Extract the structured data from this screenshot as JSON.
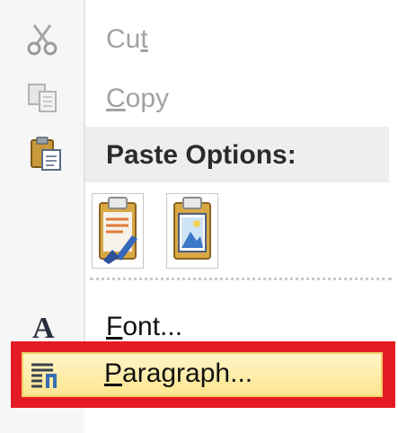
{
  "menu": {
    "cut": {
      "prefix": "Cu",
      "mnemonic": "t",
      "suffix": "",
      "icon": "scissors-icon",
      "enabled": false
    },
    "copy": {
      "prefix": "",
      "mnemonic": "C",
      "suffix": "opy",
      "icon": "copy-icon",
      "enabled": false
    },
    "paste_options": {
      "label": "Paste Options:",
      "icon": "clipboard-icon"
    },
    "paste_buttons": [
      {
        "name": "keep-text-only",
        "icon": "paste-text-only-icon"
      },
      {
        "name": "picture",
        "icon": "paste-picture-icon"
      }
    ],
    "font": {
      "prefix": "",
      "mnemonic": "F",
      "suffix": "ont...",
      "icon": "font-icon",
      "glyph": "A"
    },
    "paragraph": {
      "prefix": "",
      "mnemonic": "P",
      "suffix": "aragraph...",
      "icon": "paragraph-icon",
      "highlighted": true
    }
  },
  "colors": {
    "highlight_border": "#e41b23",
    "hover_fill": "#fde58f",
    "disabled_text": "#a2a2a2",
    "enabled_text": "#111111"
  }
}
